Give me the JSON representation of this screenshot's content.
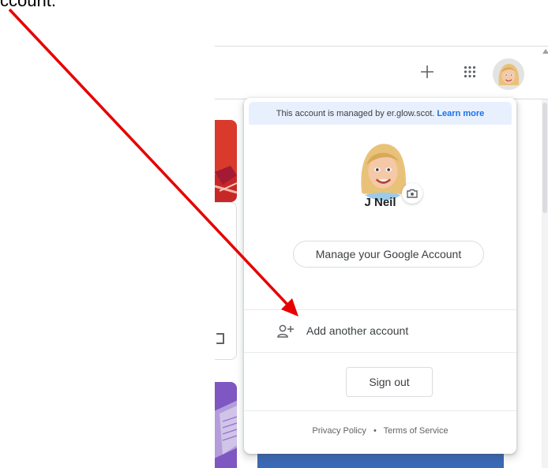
{
  "caption": {
    "text": "ccount."
  },
  "header": {
    "plus_icon": "plus-icon",
    "apps_icon": "apps-grid-icon",
    "avatar": "user-avatar"
  },
  "popup": {
    "managed_text": "This account is managed by",
    "managed_domain": "er.glow.scot.",
    "learn_more": "Learn more",
    "user_name": "J Neil",
    "manage_button": "Manage your Google Account",
    "add_account": "Add another account",
    "sign_out": "Sign out",
    "footer": {
      "privacy": "Privacy Policy",
      "separator": "•",
      "terms": "Terms of Service"
    }
  },
  "colors": {
    "annotation_arrow": "#e60000",
    "link": "#1a73e8",
    "managed_bg": "#e8f0fe",
    "card_red": "#d93a2b",
    "card_purple": "#7e57c2"
  }
}
